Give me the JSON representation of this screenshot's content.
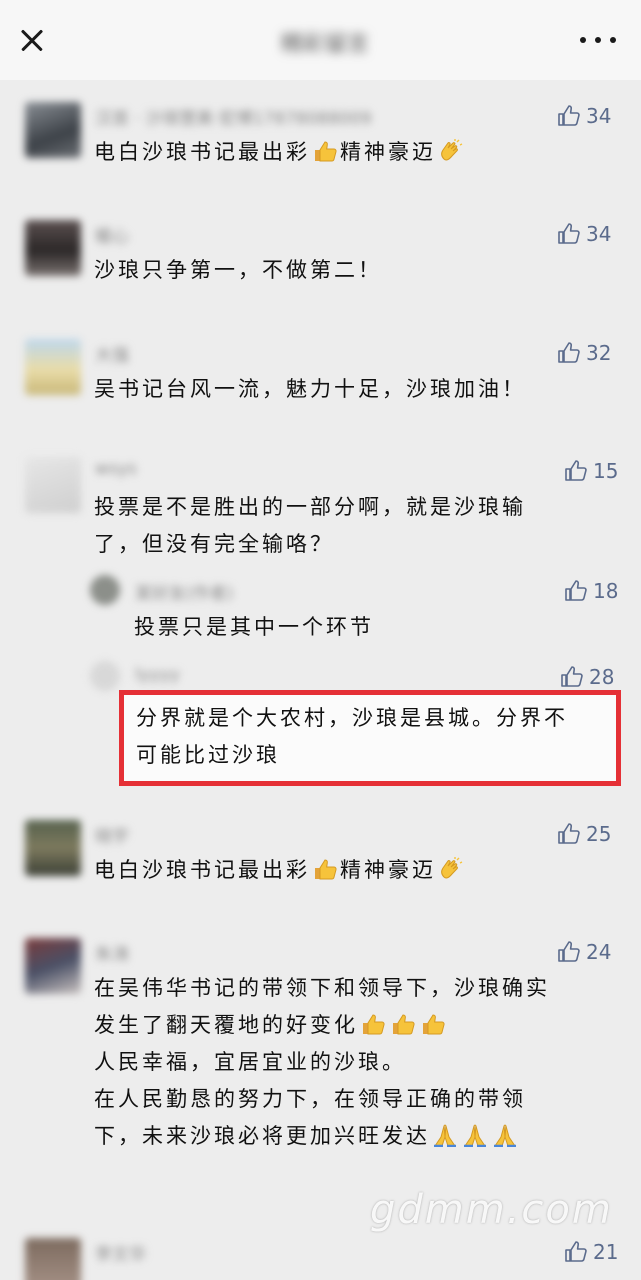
{
  "header": {
    "title": "精彩留言",
    "close_icon": "close-icon",
    "more_icon": "more-dots-icon"
  },
  "comments": [
    {
      "name": "汉首 · 沙琅慧美·宏博17878088009",
      "text_lines": [
        "电白沙琅书记最出彩",
        "精神豪迈"
      ],
      "likes": "34"
    },
    {
      "name": "暖心",
      "text_lines": [
        "沙琅只争第一，不做第二！"
      ],
      "likes": "34"
    },
    {
      "name": "大强",
      "text_lines": [
        "吴书记台风一流，魅力十足，沙琅加油！"
      ],
      "likes": "32"
    },
    {
      "name": "wsys",
      "text_lines": [
        "投票是不是胜出的一部分啊，就是沙琅输",
        "了，但没有完全输咯？"
      ],
      "likes": "15",
      "replies": [
        {
          "name": "某好友(作者)",
          "text_lines": [
            "投票只是其中一个环节"
          ],
          "likes": "18"
        },
        {
          "name": "lyyyy",
          "text_lines": [
            "分界就是个大农村，沙琅是县城。分界不",
            "可能比过沙琅"
          ],
          "likes": "28"
        }
      ]
    },
    {
      "name": "晓宇",
      "text_lines": [
        "电白沙琅书记最出彩",
        "精神豪迈"
      ],
      "likes": "25"
    },
    {
      "name": "朱涛",
      "text_lines": [
        "在吴伟华书记的带领下和领导下，沙琅确实",
        "发生了翻天覆地的好变化",
        "人民幸福，宜居宜业的沙琅。",
        "在人民勤恳的努力下，在领导正确的带领",
        "下，未来沙琅必将更加兴旺发达"
      ],
      "likes": "24"
    },
    {
      "name": "李文华",
      "text_lines": [],
      "likes": "21"
    }
  ],
  "emoji": {
    "thumbs_up": "thumbs-up-emoji",
    "clapping": "clapping-hands-emoji",
    "praying": "folded-hands-emoji"
  },
  "watermark": "gdmm.com",
  "colors": {
    "background": "#ededed",
    "like_count": "#5b6b8c",
    "highlight_border": "#e53036"
  }
}
